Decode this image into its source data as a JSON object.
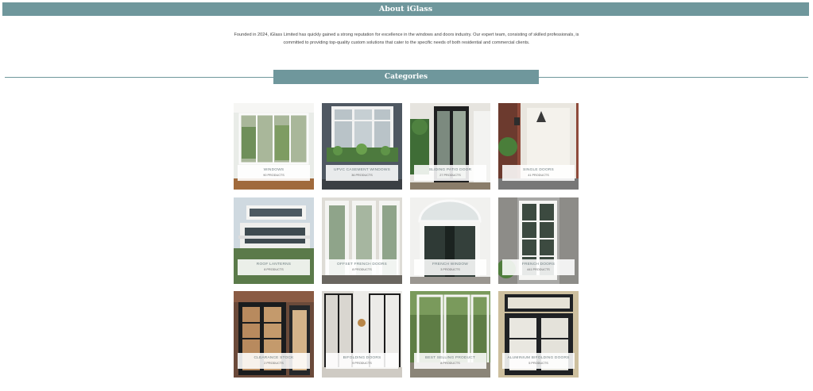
{
  "about": {
    "title": "About iGlass",
    "text": "Founded in 2024, iGlass Limited has quickly gained a strong reputation for excellence in the windows and doors industry. Our expert team, consisting of skilled professionals, is committed to providing top-quality custom solutions that cater to the specific needs of both residential and commercial clients."
  },
  "categories": {
    "title": "Categories",
    "items": [
      {
        "name": "WINDOWS",
        "count": "90 PRODUCTS"
      },
      {
        "name": "UPVC CASEMENT WINDOWS",
        "count": "36 PRODUCTS"
      },
      {
        "name": "SLIDING PATIO DOOR",
        "count": "27 PRODUCTS"
      },
      {
        "name": "SINGLE DOORS",
        "count": "41 PRODUCTS"
      },
      {
        "name": "ROOF LANTERNS",
        "count": "8 PRODUCTS"
      },
      {
        "name": "OFFSET FRENCH DOORS",
        "count": "8 PRODUCTS"
      },
      {
        "name": "FRENCH WINDOW",
        "count": "3 PRODUCTS"
      },
      {
        "name": "FRENCH DOORS",
        "count": "441 PRODUCTS"
      },
      {
        "name": "CLEARANCE STOCK",
        "count": "2 PRODUCTS"
      },
      {
        "name": "BIFOLDING DOORS",
        "count": "9 PRODUCTS"
      },
      {
        "name": "BEST SELLING PRODUCT",
        "count": "8 PRODUCTS"
      },
      {
        "name": "ALUMINIUM BIFOLDING DOORS",
        "count": "5 PRODUCTS"
      }
    ]
  }
}
